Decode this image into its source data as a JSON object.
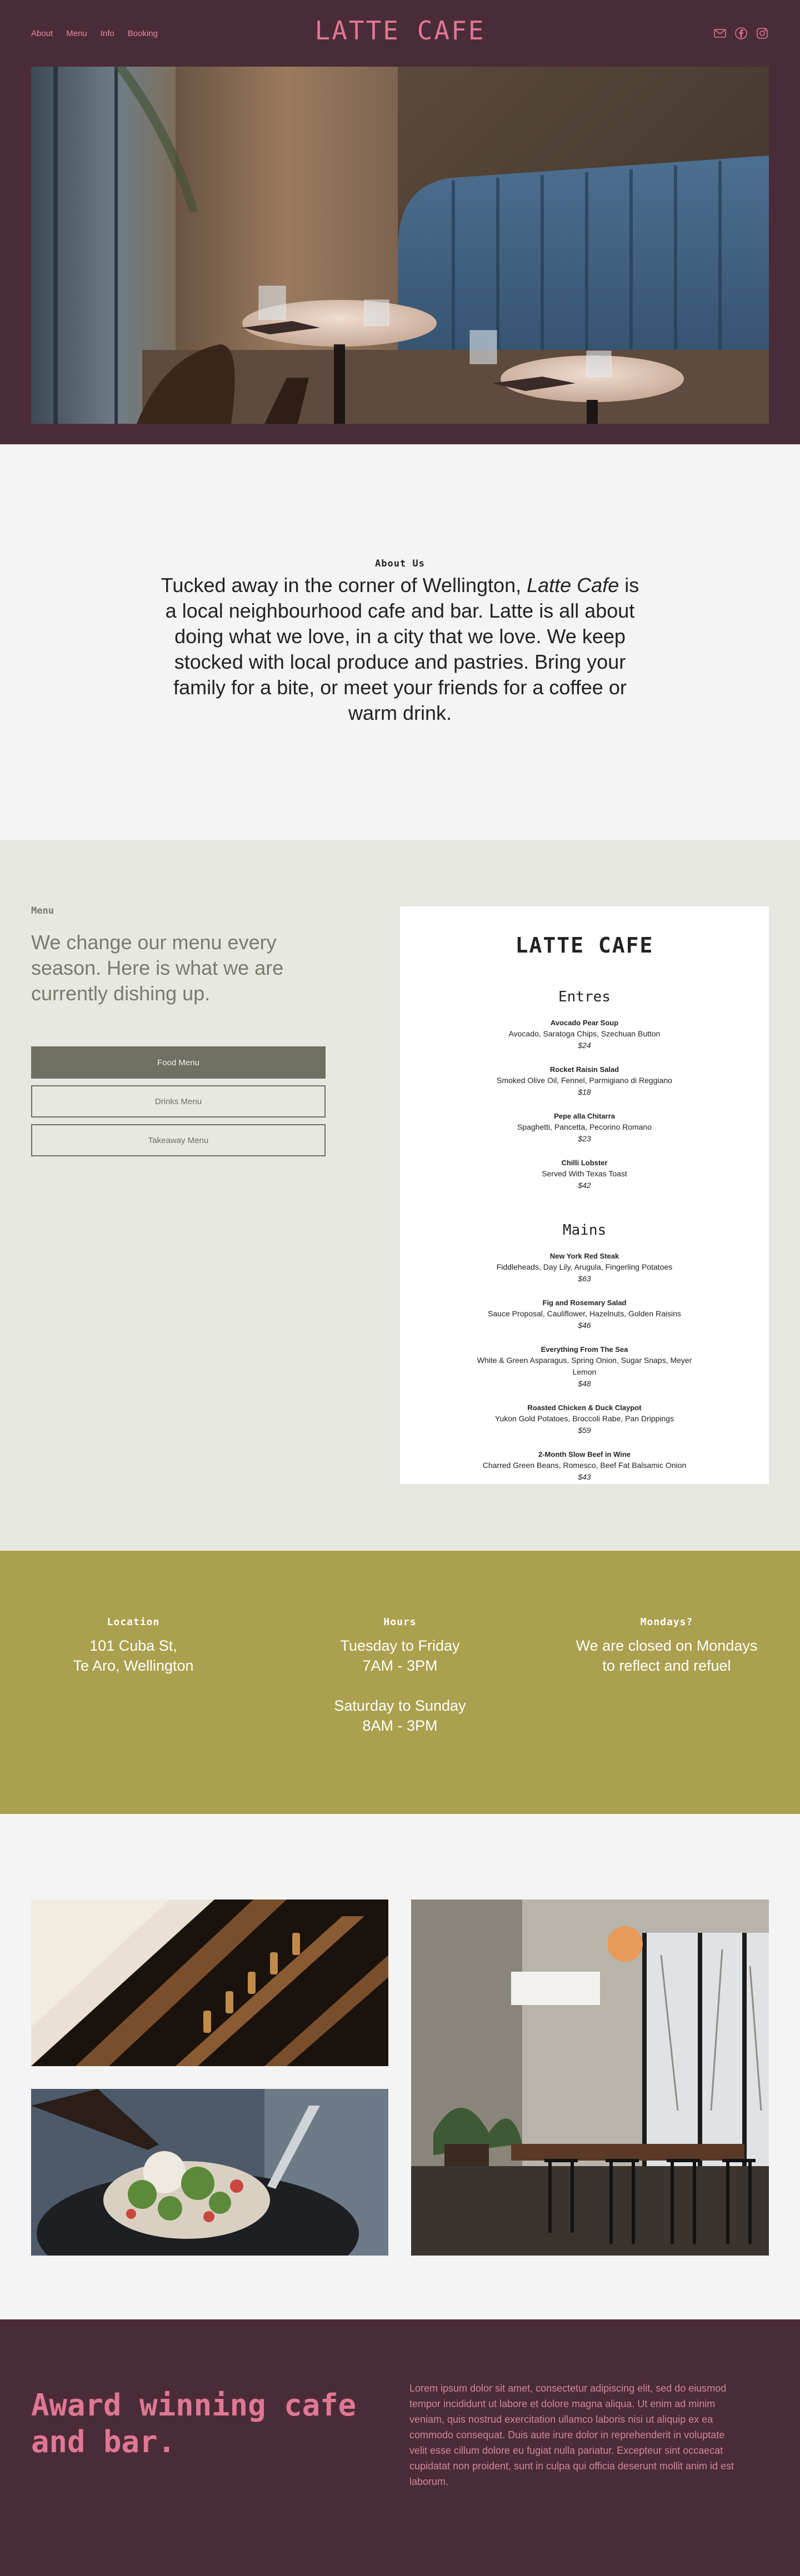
{
  "nav": {
    "links": [
      "About",
      "Menu",
      "Info",
      "Booking"
    ],
    "logo": "LATTE CAFE",
    "icons": [
      "mail-icon",
      "facebook-icon",
      "instagram-icon"
    ]
  },
  "about": {
    "label": "About Us",
    "text_before": "Tucked away in the corner of Wellington, ",
    "text_em": "Latte Cafe",
    "text_after": " is a local neighbourhood cafe and bar. Latte is all about doing what we love, in a city that we love. We keep stocked with local produce and pastries. Bring your family for a bite, or meet your friends for a coffee or warm drink."
  },
  "menu": {
    "label": "Menu",
    "intro": "We change our menu every season. Here is what we are currently dishing up.",
    "buttons": [
      "Food Menu",
      "Drinks Menu",
      "Takeaway Menu"
    ],
    "card_title": "LATTE CAFE",
    "entres_title": "Entres",
    "entres": [
      {
        "name": "Avocado Pear Soup",
        "desc": "Avocado, Saratoga Chips, Szechuan Button",
        "price": "$24"
      },
      {
        "name": "Rocket Raisin Salad",
        "desc": "Smoked Olive Oil, Fennel, Parmigiano di Reggiano",
        "price": "$18"
      },
      {
        "name": "Pepe alla Chitarra",
        "desc": "Spaghetti, Pancetta, Pecorino Romano",
        "price": "$23"
      },
      {
        "name": "Chilli Lobster",
        "desc": "Served With Texas Toast",
        "price": "$42"
      }
    ],
    "mains_title": "Mains",
    "mains": [
      {
        "name": "New York Red Steak",
        "desc": "Fiddleheads, Day Lily, Arugula, Fingerling Potatoes",
        "price": "$63"
      },
      {
        "name": "Fig and Rosemary Salad",
        "desc": "Sauce Proposal, Cauliflower, Hazelnuts, Golden Raisins",
        "price": "$46"
      },
      {
        "name": "Everything From The Sea",
        "desc": "White & Green Asparagus, Spring Onion, Sugar Snaps, Meyer Lemon",
        "price": "$48"
      },
      {
        "name": "Roasted Chicken & Duck Claypot",
        "desc": "Yukon Gold Potatoes, Broccoli Rabe, Pan Drippings",
        "price": "$59"
      },
      {
        "name": "2-Month Slow Beef in Wine",
        "desc": "Charred Green Beans, Romesco, Beef Fat Balsamic Onion",
        "price": "$43"
      }
    ]
  },
  "info": {
    "location_title": "Location",
    "location_line1": "101 Cuba St,",
    "location_line2": "Te Aro, Wellington",
    "hours_title": "Hours",
    "hours_line1": "Tuesday to Friday",
    "hours_line2": "7AM - 3PM",
    "hours_line3": "Saturday to Sunday",
    "hours_line4": "8AM - 3PM",
    "mondays_title": "Mondays?",
    "mondays_line1": "We are closed on Mondays",
    "mondays_line2": "to reflect and refuel"
  },
  "footer": {
    "award": "Award winning cafe and bar.",
    "lorem": "Lorem ipsum dolor sit amet, consectetur adipiscing elit, sed do eiusmod tempor incididunt ut labore et dolore magna aliqua. Ut enim ad minim veniam, quis nostrud exercitation ullamco laboris nisi ut aliquip ex ea commodo consequat. Duis aute irure dolor in reprehenderit in voluptate velit esse cillum dolore eu fugiat nulla pariatur. Excepteur sint occaecat cupidatat non proident, sunt in culpa qui officia deserunt mollit anim id est laborum."
  },
  "colors": {
    "plum": "#4a2c38",
    "pink": "#e07794",
    "olive": "#aba04e",
    "stone": "#6f6f62"
  }
}
